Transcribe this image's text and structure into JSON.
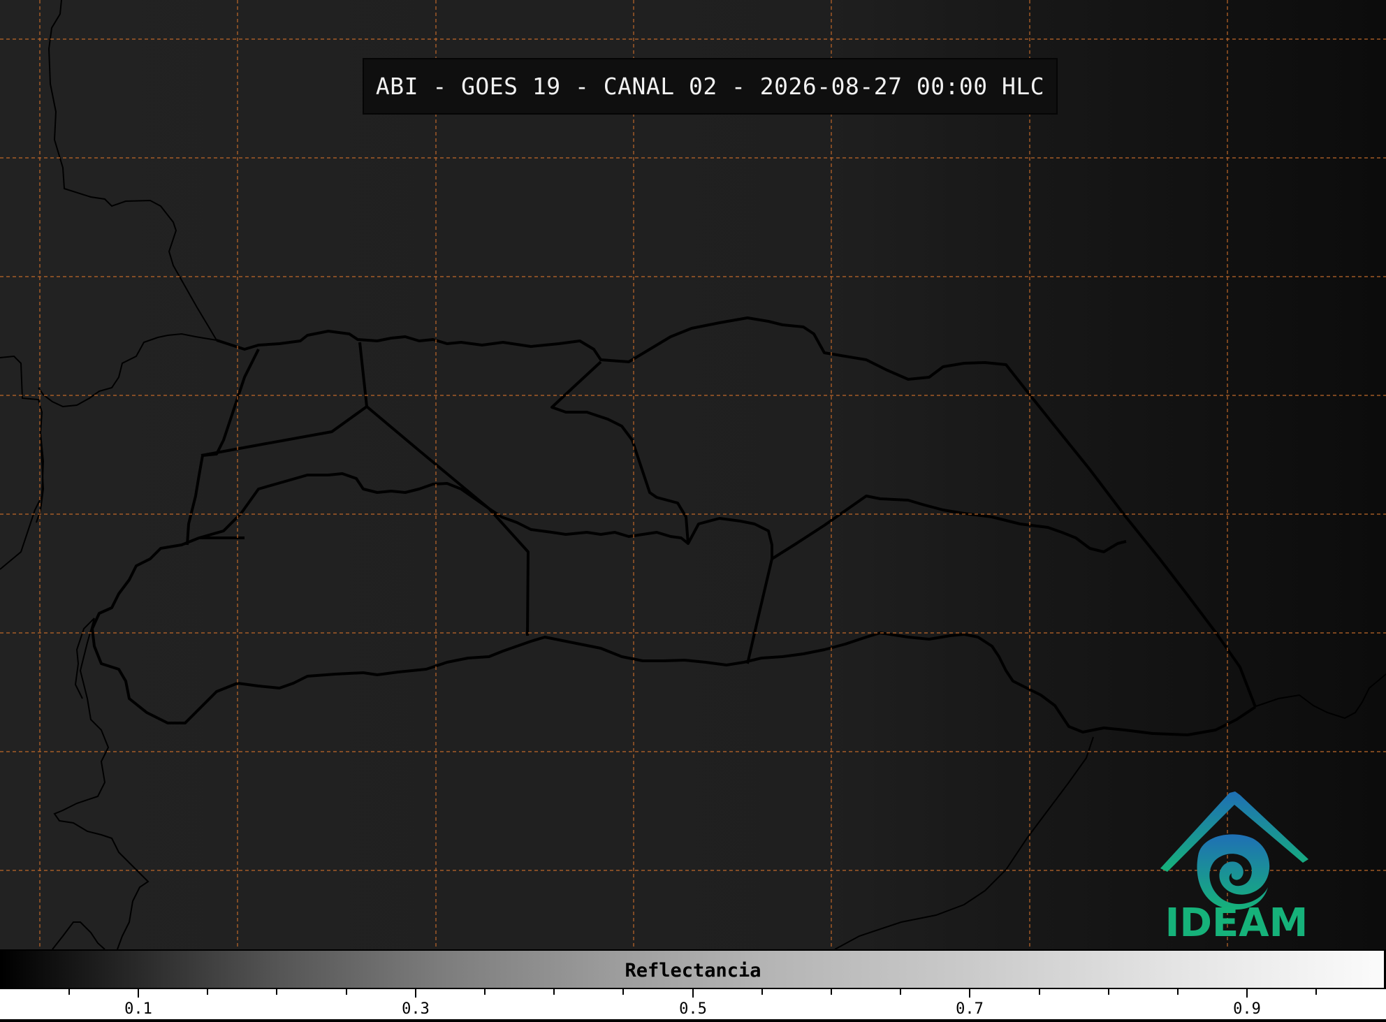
{
  "title": "ABI - GOES 19 - CANAL 02 - 2026-08-27 00:00 HLC",
  "logo": {
    "text": "IDEAM",
    "icon": "ideam-logo-icon",
    "colors": [
      "#1f6fb5",
      "#16b27a"
    ]
  },
  "map": {
    "background_color": "#1e1e1e",
    "gridline_color": "#c0682a",
    "boundary_color": "#000000",
    "gridlines": "dashed"
  },
  "colorbar": {
    "label": "Reflectancia",
    "colormap": "grayscale",
    "range": [
      0.0,
      1.0
    ],
    "tick_labels": [
      "0.1",
      "0.3",
      "0.5",
      "0.7",
      "0.9"
    ]
  }
}
